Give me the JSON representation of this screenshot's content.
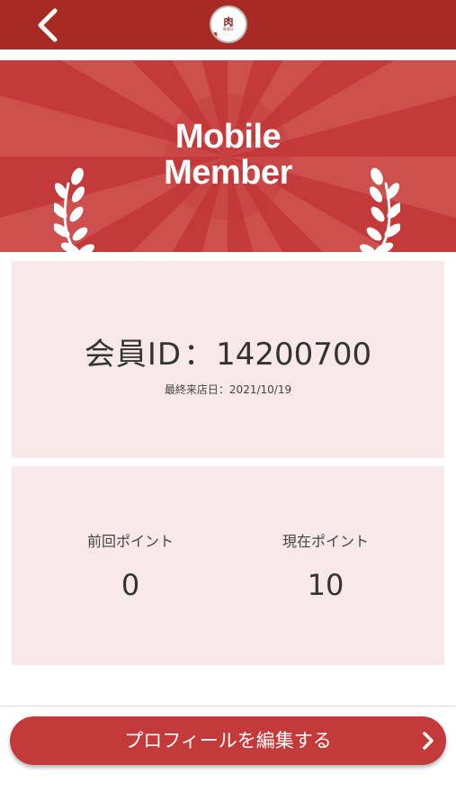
{
  "header": {
    "back_icon": "chevron-left-icon",
    "logo": {
      "kanji": "肉",
      "sub": "NIKU"
    },
    "brand_color": "#a82a22"
  },
  "banner": {
    "title_line1": "Mobile",
    "title_line2": "Member",
    "icons": [
      "laurel-left-icon",
      "laurel-right-icon"
    ],
    "color": "#c4393a"
  },
  "member": {
    "id_label": "会員ID",
    "separator": "：",
    "id_value": "14200700",
    "last_visit_label": "最終来店日：",
    "last_visit_date": "2021/10/19"
  },
  "points": {
    "previous_label": "前回ポイント",
    "previous_value": "0",
    "current_label": "現在ポイント",
    "current_value": "10"
  },
  "actions": {
    "edit_profile_label": "プロフィールを編集する",
    "edit_icon": "chevron-right-icon"
  }
}
